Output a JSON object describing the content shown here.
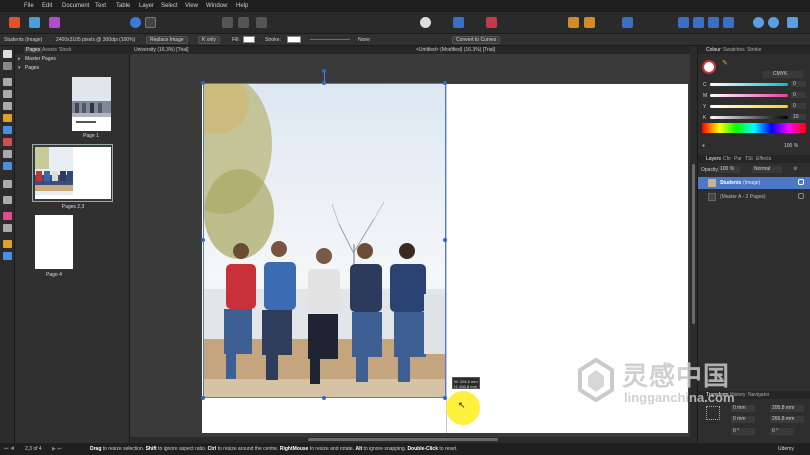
{
  "menu": [
    "File",
    "Edit",
    "Document",
    "Text",
    "Table",
    "Layer",
    "Select",
    "View",
    "Window",
    "Help"
  ],
  "context": {
    "object_type": "Students (Image)",
    "dimensions": "2400x3105 pixels @ 300dpi (100%)",
    "replace_image": "Replace Image",
    "mode": "K only",
    "fill_label": "Fill:",
    "stroke_label": "Stroke:",
    "stroke_style": "None",
    "convert_label": "Convert to Curves"
  },
  "pages_panel": {
    "tabs": [
      "Pages",
      "Assets",
      "Stock"
    ],
    "master_pages": "Master Pages",
    "pages_label": "Pages",
    "thumbs": [
      "Page 1",
      "Pages 2,3",
      "Page 4"
    ]
  },
  "doc_tabs": [
    "University (16.3%) [Trial]",
    "<Untitled> (Modified) (16.3%) [Trial]"
  ],
  "right_panel": {
    "top_tabs": [
      "Colour",
      "Swatches",
      "Stroke"
    ],
    "color_model": "CMYK",
    "sliders": [
      {
        "label": "C",
        "value": "0",
        "color": "#00bcd4"
      },
      {
        "label": "M",
        "value": "0",
        "color": "#e040a0"
      },
      {
        "label": "Y",
        "value": "0",
        "color": "#f5d31a"
      },
      {
        "label": "K",
        "value": "10",
        "color": "#888888"
      }
    ],
    "opacity_value": "100 %",
    "layer_tabs": [
      "Layers",
      "Chr",
      "Par",
      "TSt",
      "Effects"
    ],
    "opacity_label": "Opacity:",
    "layer_opacity": "100 %",
    "blend_mode": "Normal",
    "layers": [
      {
        "name": "Students",
        "kind": "(Image)",
        "selected": true
      },
      {
        "name": "(Master A - 2 Pages)",
        "kind": "",
        "selected": false
      }
    ],
    "transform_tabs": [
      "Transform",
      "History",
      "Navigator"
    ],
    "transform": {
      "x": "0 mm",
      "y": "0 mm",
      "w": "205,8 mm",
      "h": "266,8 mm",
      "r": "0 °",
      "s": "0 °"
    }
  },
  "dim_tooltip": {
    "w": "W: 206,0 mm",
    "h": "H: 266,8 mm"
  },
  "status": {
    "page_indicator": "2,3 of 4",
    "parts": [
      {
        "key": "Drag",
        "text": " to resize selection. "
      },
      {
        "key": "Shift",
        "text": " to ignore aspect ratio. "
      },
      {
        "key": "Ctrl",
        "text": " to resize around the centre. "
      },
      {
        "key": "RightMouse",
        "text": " to resize and rotate. "
      },
      {
        "key": "Alt",
        "text": " to ignore snapping. "
      },
      {
        "key": "Double-Click",
        "text": " to reset."
      }
    ],
    "brand": "Udemy"
  },
  "watermark": {
    "cn": "灵感中国",
    "url": "lingganchina.com"
  },
  "colors": {
    "accent": "#2f68c9",
    "cursor_halo": "#ffef2e",
    "selected_layer": "#4d78c7"
  }
}
